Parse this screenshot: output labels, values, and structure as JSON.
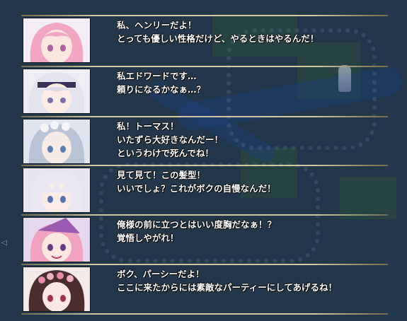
{
  "dialogues": [
    {
      "speaker_icon": "pink-hair-girl-portrait",
      "lines": [
        "私、ヘンリーだよ！",
        "とっても優しい性格だけど、やるときはやるんだ！"
      ],
      "hair": "#f2a6c4",
      "accent": "#b05fa0"
    },
    {
      "speaker_icon": "white-veil-nun-portrait",
      "lines": [
        "私エドワードです…",
        "頼りになるかなぁ…？"
      ],
      "hair": "#d8d8e6",
      "accent": "#3a2f55"
    },
    {
      "speaker_icon": "silver-hair-flower-crown-portrait",
      "lines": [
        "私！トーマス！",
        "いたずら大好きなんだー！",
        "というわけで死んでね！"
      ],
      "hair": "#b9c3d6",
      "accent": "#8fa2c8"
    },
    {
      "speaker_icon": "white-hair-boy-portrait",
      "lines": [
        "見て見て！この髪型！",
        "いいでしょ？これがボクの自慢なんだ！"
      ],
      "hair": "#e6e3f0",
      "accent": "#8a70b8"
    },
    {
      "speaker_icon": "pink-hair-witch-hat-portrait",
      "lines": [
        "俺様の前に立つとはいい度胸だなぁ！？",
        "覚悟しやがれ！"
      ],
      "hair": "#f0a2c0",
      "accent": "#9a5ab0"
    },
    {
      "speaker_icon": "dark-hair-flower-wreath-portrait",
      "lines": [
        "ボク、パーシーだよ！",
        "ここに来たからには素敵なパーティーにしてあげるね！"
      ],
      "hair": "#4a2e2e",
      "accent": "#e58aa8"
    }
  ]
}
